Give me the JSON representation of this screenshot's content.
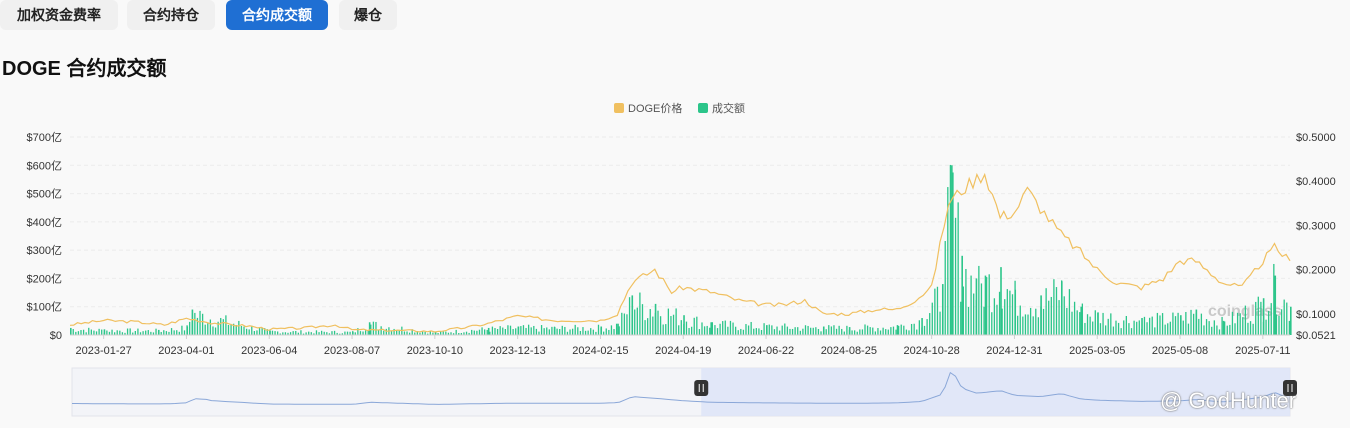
{
  "tabs": [
    {
      "label": "加权资金费率",
      "active": false
    },
    {
      "label": "合约持仓",
      "active": false
    },
    {
      "label": "合约成交额",
      "active": true
    },
    {
      "label": "爆仓",
      "active": false
    }
  ],
  "page_title": "DOGE 合约成交额",
  "watermark": "@ GodHunter",
  "chart_watermark": "coinglass",
  "colors": {
    "price": "#f0c060",
    "volume": "#2cc58a",
    "accent": "#1f6fd3",
    "navigator": "#8aa7d8"
  },
  "chart_data": {
    "type": "bar+line",
    "title": "",
    "legend": {
      "position": "top-center",
      "items": [
        {
          "name": "DOGE价格",
          "color": "#f0c060"
        },
        {
          "name": "成交额",
          "color": "#2cc58a"
        }
      ]
    },
    "x_tick_labels": [
      "2023-01-27",
      "2023-04-01",
      "2023-06-04",
      "2023-08-07",
      "2023-10-10",
      "2023-12-13",
      "2024-02-15",
      "2024-04-19",
      "2024-06-22",
      "2024-08-25",
      "2024-10-28",
      "2024-12-31",
      "2025-03-05",
      "2025-05-08",
      "2025-07-11"
    ],
    "left_axis": {
      "ticks": [
        "$0",
        "$100亿",
        "$200亿",
        "$300亿",
        "$400亿",
        "$500亿",
        "$600亿",
        "$700亿"
      ],
      "range": [
        0,
        700
      ],
      "unit": "亿 USD"
    },
    "right_axis": {
      "ticks": [
        "$0.0521",
        "$0.1000",
        "$0.2000",
        "$0.3000",
        "$0.4000",
        "$0.5000"
      ],
      "range": [
        0.0521,
        0.5
      ]
    },
    "grid": true,
    "series": [
      {
        "name": "DOGE价格",
        "type": "line",
        "axis": "right",
        "x": [
          "2023-01-01",
          "2023-01-27",
          "2023-02-20",
          "2023-03-15",
          "2023-04-01",
          "2023-04-20",
          "2023-05-20",
          "2023-06-04",
          "2023-07-01",
          "2023-07-25",
          "2023-08-07",
          "2023-08-25",
          "2023-09-20",
          "2023-10-10",
          "2023-11-05",
          "2023-11-20",
          "2023-12-13",
          "2024-01-10",
          "2024-02-15",
          "2024-02-28",
          "2024-03-10",
          "2024-03-28",
          "2024-04-10",
          "2024-04-19",
          "2024-05-10",
          "2024-06-01",
          "2024-06-22",
          "2024-07-05",
          "2024-07-22",
          "2024-08-05",
          "2024-08-25",
          "2024-09-15",
          "2024-10-01",
          "2024-10-15",
          "2024-10-28",
          "2024-11-10",
          "2024-11-20",
          "2024-12-08",
          "2024-12-20",
          "2024-12-31",
          "2025-01-10",
          "2025-01-20",
          "2025-02-05",
          "2025-02-20",
          "2025-03-05",
          "2025-03-20",
          "2025-04-08",
          "2025-04-25",
          "2025-05-08",
          "2025-05-20",
          "2025-06-10",
          "2025-06-25",
          "2025-07-11",
          "2025-07-20",
          "2025-08-01"
        ],
        "values": [
          0.075,
          0.085,
          0.082,
          0.075,
          0.09,
          0.08,
          0.072,
          0.065,
          0.068,
          0.075,
          0.064,
          0.063,
          0.062,
          0.06,
          0.07,
          0.078,
          0.095,
          0.085,
          0.085,
          0.1,
          0.17,
          0.2,
          0.15,
          0.16,
          0.15,
          0.13,
          0.12,
          0.12,
          0.13,
          0.1,
          0.1,
          0.11,
          0.11,
          0.13,
          0.16,
          0.35,
          0.38,
          0.42,
          0.32,
          0.33,
          0.38,
          0.34,
          0.28,
          0.24,
          0.2,
          0.17,
          0.16,
          0.18,
          0.22,
          0.22,
          0.17,
          0.16,
          0.22,
          0.25,
          0.22
        ]
      },
      {
        "name": "成交额",
        "type": "bar",
        "axis": "left",
        "unit": "亿 USD",
        "x": [
          "2023-01-01",
          "2023-01-27",
          "2023-03-10",
          "2023-04-01",
          "2023-04-05",
          "2023-06-04",
          "2023-08-07",
          "2023-08-20",
          "2023-10-10",
          "2023-11-20",
          "2023-12-13",
          "2024-01-10",
          "2024-02-15",
          "2024-02-28",
          "2024-03-10",
          "2024-03-28",
          "2024-04-19",
          "2024-05-10",
          "2024-06-22",
          "2024-08-05",
          "2024-08-25",
          "2024-10-01",
          "2024-10-20",
          "2024-11-05",
          "2024-11-12",
          "2024-11-20",
          "2024-12-01",
          "2024-12-08",
          "2024-12-20",
          "2024-12-31",
          "2025-01-20",
          "2025-02-05",
          "2025-02-20",
          "2025-03-05",
          "2025-04-08",
          "2025-05-08",
          "2025-05-20",
          "2025-06-10",
          "2025-07-11",
          "2025-07-20",
          "2025-08-01"
        ],
        "values": [
          25,
          20,
          18,
          30,
          90,
          15,
          12,
          45,
          10,
          25,
          30,
          28,
          30,
          40,
          140,
          110,
          70,
          45,
          35,
          30,
          28,
          35,
          60,
          180,
          600,
          280,
          200,
          210,
          240,
          160,
          140,
          190,
          100,
          80,
          60,
          70,
          90,
          50,
          130,
          210,
          100
        ]
      }
    ],
    "navigator": {
      "selected_range": [
        "2024-04-19",
        "2025-08-01"
      ]
    }
  }
}
